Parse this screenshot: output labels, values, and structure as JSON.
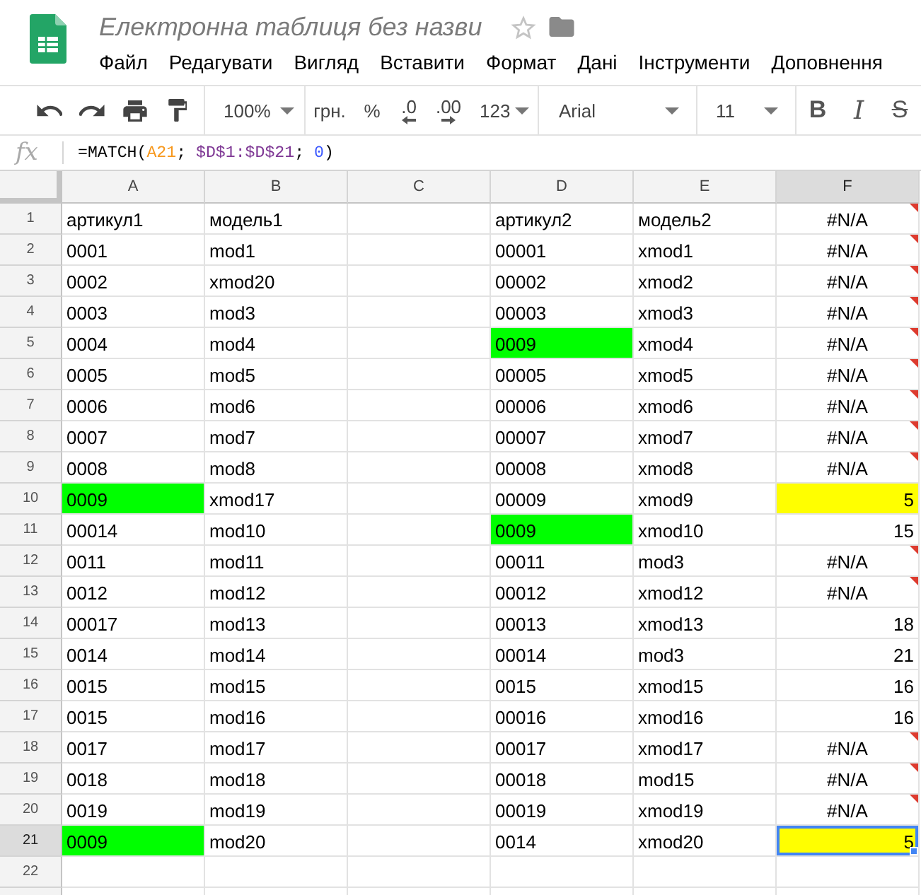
{
  "header": {
    "title": "Електронна таблиця без назви",
    "starred": false,
    "menu": [
      "Файл",
      "Редагувати",
      "Вигляд",
      "Вставити",
      "Формат",
      "Дані",
      "Інструменти",
      "Доповнення"
    ]
  },
  "toolbar": {
    "zoom": "100%",
    "currency": "грн.",
    "percent": "%",
    "decrease_decimals": ".0",
    "increase_decimals": ".00",
    "number_format": "123",
    "font": "Arial",
    "font_size": "11",
    "bold": "B",
    "italic": "I",
    "strikethrough": "S"
  },
  "formula_bar": {
    "label": "fx",
    "formula": [
      {
        "text": "=MATCH(",
        "color": "#000000"
      },
      {
        "text": "A21",
        "color": "#f7981d"
      },
      {
        "text": "; ",
        "color": "#000000"
      },
      {
        "text": "$D$1:$D$21",
        "color": "#7e3794"
      },
      {
        "text": "; ",
        "color": "#000000"
      },
      {
        "text": "0",
        "color": "#3d5afe"
      },
      {
        "text": ")",
        "color": "#000000"
      }
    ]
  },
  "sheet": {
    "columns": [
      {
        "label": "A",
        "selected": false
      },
      {
        "label": "B",
        "selected": false
      },
      {
        "label": "C",
        "selected": false
      },
      {
        "label": "D",
        "selected": false
      },
      {
        "label": "E",
        "selected": false
      },
      {
        "label": "F",
        "selected": true
      }
    ],
    "rows": [
      {
        "number": "1",
        "selected": false,
        "cells": [
          {
            "text": "артикул1",
            "kind": "text",
            "selected": false
          },
          {
            "text": "модель1",
            "kind": "text",
            "selected": false
          },
          {
            "selected": false
          },
          {
            "text": "артикул2",
            "kind": "text",
            "selected": false
          },
          {
            "text": "модель2",
            "kind": "text",
            "selected": false
          },
          {
            "text": "#N/A",
            "kind": "error",
            "selected": false
          }
        ]
      },
      {
        "number": "2",
        "selected": false,
        "cells": [
          {
            "text": "0001",
            "kind": "text",
            "selected": false
          },
          {
            "text": "mod1",
            "kind": "text",
            "selected": false
          },
          {
            "selected": false
          },
          {
            "text": "00001",
            "kind": "text",
            "selected": false
          },
          {
            "text": "xmod1",
            "kind": "text",
            "selected": false
          },
          {
            "text": "#N/A",
            "kind": "error",
            "selected": false
          }
        ]
      },
      {
        "number": "3",
        "selected": false,
        "cells": [
          {
            "text": "0002",
            "kind": "text",
            "selected": false
          },
          {
            "text": "xmod20",
            "kind": "text",
            "selected": false
          },
          {
            "selected": false
          },
          {
            "text": "00002",
            "kind": "text",
            "selected": false
          },
          {
            "text": "xmod2",
            "kind": "text",
            "selected": false
          },
          {
            "text": "#N/A",
            "kind": "error",
            "selected": false
          }
        ]
      },
      {
        "number": "4",
        "selected": false,
        "cells": [
          {
            "text": "0003",
            "kind": "text",
            "selected": false
          },
          {
            "text": "mod3",
            "kind": "text",
            "selected": false
          },
          {
            "selected": false
          },
          {
            "text": "00003",
            "kind": "text",
            "selected": false
          },
          {
            "text": "xmod3",
            "kind": "text",
            "selected": false
          },
          {
            "text": "#N/A",
            "kind": "error",
            "selected": false
          }
        ]
      },
      {
        "number": "5",
        "selected": false,
        "cells": [
          {
            "text": "0004",
            "kind": "text",
            "selected": false
          },
          {
            "text": "mod4",
            "kind": "text",
            "selected": false
          },
          {
            "selected": false
          },
          {
            "text": "0009",
            "kind": "text",
            "selected": false,
            "color": "#00ff00"
          },
          {
            "text": "xmod4",
            "kind": "text",
            "selected": false
          },
          {
            "text": "#N/A",
            "kind": "error",
            "selected": false
          }
        ]
      },
      {
        "number": "6",
        "selected": false,
        "cells": [
          {
            "text": "0005",
            "kind": "text",
            "selected": false
          },
          {
            "text": "mod5",
            "kind": "text",
            "selected": false
          },
          {
            "selected": false
          },
          {
            "text": "00005",
            "kind": "text",
            "selected": false
          },
          {
            "text": "xmod5",
            "kind": "text",
            "selected": false
          },
          {
            "text": "#N/A",
            "kind": "error",
            "selected": false
          }
        ]
      },
      {
        "number": "7",
        "selected": false,
        "cells": [
          {
            "text": "0006",
            "kind": "text",
            "selected": false
          },
          {
            "text": "mod6",
            "kind": "text",
            "selected": false
          },
          {
            "selected": false
          },
          {
            "text": "00006",
            "kind": "text",
            "selected": false
          },
          {
            "text": "xmod6",
            "kind": "text",
            "selected": false
          },
          {
            "text": "#N/A",
            "kind": "error",
            "selected": false
          }
        ]
      },
      {
        "number": "8",
        "selected": false,
        "cells": [
          {
            "text": "0007",
            "kind": "text",
            "selected": false
          },
          {
            "text": "mod7",
            "kind": "text",
            "selected": false
          },
          {
            "selected": false
          },
          {
            "text": "00007",
            "kind": "text",
            "selected": false
          },
          {
            "text": "xmod7",
            "kind": "text",
            "selected": false
          },
          {
            "text": "#N/A",
            "kind": "error",
            "selected": false
          }
        ]
      },
      {
        "number": "9",
        "selected": false,
        "cells": [
          {
            "text": "0008",
            "kind": "text",
            "selected": false
          },
          {
            "text": "mod8",
            "kind": "text",
            "selected": false
          },
          {
            "selected": false
          },
          {
            "text": "00008",
            "kind": "text",
            "selected": false
          },
          {
            "text": "xmod8",
            "kind": "text",
            "selected": false
          },
          {
            "text": "#N/A",
            "kind": "error",
            "selected": false
          }
        ]
      },
      {
        "number": "10",
        "selected": false,
        "cells": [
          {
            "text": "0009",
            "kind": "text",
            "selected": false,
            "color": "#00ff00"
          },
          {
            "text": "xmod17",
            "kind": "text",
            "selected": false
          },
          {
            "selected": false
          },
          {
            "text": "00009",
            "kind": "text",
            "selected": false
          },
          {
            "text": "xmod9",
            "kind": "text",
            "selected": false
          },
          {
            "text": "5",
            "kind": "number",
            "selected": false,
            "color": "#ffff00"
          }
        ]
      },
      {
        "number": "11",
        "selected": false,
        "cells": [
          {
            "text": "00014",
            "kind": "text",
            "selected": false
          },
          {
            "text": "mod10",
            "kind": "text",
            "selected": false
          },
          {
            "selected": false
          },
          {
            "text": "0009",
            "kind": "text",
            "selected": false,
            "color": "#00ff00"
          },
          {
            "text": "xmod10",
            "kind": "text",
            "selected": false
          },
          {
            "text": "15",
            "kind": "number",
            "selected": false
          }
        ]
      },
      {
        "number": "12",
        "selected": false,
        "cells": [
          {
            "text": "0011",
            "kind": "text",
            "selected": false
          },
          {
            "text": "mod11",
            "kind": "text",
            "selected": false
          },
          {
            "selected": false
          },
          {
            "text": "00011",
            "kind": "text",
            "selected": false
          },
          {
            "text": "mod3",
            "kind": "text",
            "selected": false
          },
          {
            "text": "#N/A",
            "kind": "error",
            "selected": false
          }
        ]
      },
      {
        "number": "13",
        "selected": false,
        "cells": [
          {
            "text": "0012",
            "kind": "text",
            "selected": false
          },
          {
            "text": "mod12",
            "kind": "text",
            "selected": false
          },
          {
            "selected": false
          },
          {
            "text": "00012",
            "kind": "text",
            "selected": false
          },
          {
            "text": "xmod12",
            "kind": "text",
            "selected": false
          },
          {
            "text": "#N/A",
            "kind": "error",
            "selected": false
          }
        ]
      },
      {
        "number": "14",
        "selected": false,
        "cells": [
          {
            "text": "00017",
            "kind": "text",
            "selected": false
          },
          {
            "text": "mod13",
            "kind": "text",
            "selected": false
          },
          {
            "selected": false
          },
          {
            "text": "00013",
            "kind": "text",
            "selected": false
          },
          {
            "text": "xmod13",
            "kind": "text",
            "selected": false
          },
          {
            "text": "18",
            "kind": "number",
            "selected": false
          }
        ]
      },
      {
        "number": "15",
        "selected": false,
        "cells": [
          {
            "text": "0014",
            "kind": "text",
            "selected": false
          },
          {
            "text": "mod14",
            "kind": "text",
            "selected": false
          },
          {
            "selected": false
          },
          {
            "text": "00014",
            "kind": "text",
            "selected": false
          },
          {
            "text": "mod3",
            "kind": "text",
            "selected": false
          },
          {
            "text": "21",
            "kind": "number",
            "selected": false
          }
        ]
      },
      {
        "number": "16",
        "selected": false,
        "cells": [
          {
            "text": "0015",
            "kind": "text",
            "selected": false
          },
          {
            "text": "mod15",
            "kind": "text",
            "selected": false
          },
          {
            "selected": false
          },
          {
            "text": "0015",
            "kind": "text",
            "selected": false
          },
          {
            "text": "xmod15",
            "kind": "text",
            "selected": false
          },
          {
            "text": "16",
            "kind": "number",
            "selected": false
          }
        ]
      },
      {
        "number": "17",
        "selected": false,
        "cells": [
          {
            "text": "0015",
            "kind": "text",
            "selected": false
          },
          {
            "text": "mod16",
            "kind": "text",
            "selected": false
          },
          {
            "selected": false
          },
          {
            "text": "00016",
            "kind": "text",
            "selected": false
          },
          {
            "text": "xmod16",
            "kind": "text",
            "selected": false
          },
          {
            "text": "16",
            "kind": "number",
            "selected": false
          }
        ]
      },
      {
        "number": "18",
        "selected": false,
        "cells": [
          {
            "text": "0017",
            "kind": "text",
            "selected": false
          },
          {
            "text": "mod17",
            "kind": "text",
            "selected": false
          },
          {
            "selected": false
          },
          {
            "text": "00017",
            "kind": "text",
            "selected": false
          },
          {
            "text": "xmod17",
            "kind": "text",
            "selected": false
          },
          {
            "text": "#N/A",
            "kind": "error",
            "selected": false
          }
        ]
      },
      {
        "number": "19",
        "selected": false,
        "cells": [
          {
            "text": "0018",
            "kind": "text",
            "selected": false
          },
          {
            "text": "mod18",
            "kind": "text",
            "selected": false
          },
          {
            "selected": false
          },
          {
            "text": "00018",
            "kind": "text",
            "selected": false
          },
          {
            "text": "mod15",
            "kind": "text",
            "selected": false
          },
          {
            "text": "#N/A",
            "kind": "error",
            "selected": false
          }
        ]
      },
      {
        "number": "20",
        "selected": false,
        "cells": [
          {
            "text": "0019",
            "kind": "text",
            "selected": false
          },
          {
            "text": "mod19",
            "kind": "text",
            "selected": false
          },
          {
            "selected": false
          },
          {
            "text": "00019",
            "kind": "text",
            "selected": false
          },
          {
            "text": "xmod19",
            "kind": "text",
            "selected": false
          },
          {
            "text": "#N/A",
            "kind": "error",
            "selected": false
          }
        ]
      },
      {
        "number": "21",
        "selected": true,
        "cells": [
          {
            "text": "0009",
            "kind": "text",
            "selected": false,
            "color": "#00ff00"
          },
          {
            "text": "mod20",
            "kind": "text",
            "selected": false
          },
          {
            "selected": false
          },
          {
            "text": "0014",
            "kind": "text",
            "selected": false
          },
          {
            "text": "xmod20",
            "kind": "text",
            "selected": false
          },
          {
            "text": "5",
            "kind": "number",
            "selected": true,
            "color": "#ffff00"
          }
        ]
      },
      {
        "number": "22",
        "selected": false,
        "cells": [
          {
            "selected": false
          },
          {
            "selected": false
          },
          {
            "selected": false
          },
          {
            "selected": false
          },
          {
            "selected": false
          },
          {
            "selected": false
          }
        ]
      }
    ]
  }
}
